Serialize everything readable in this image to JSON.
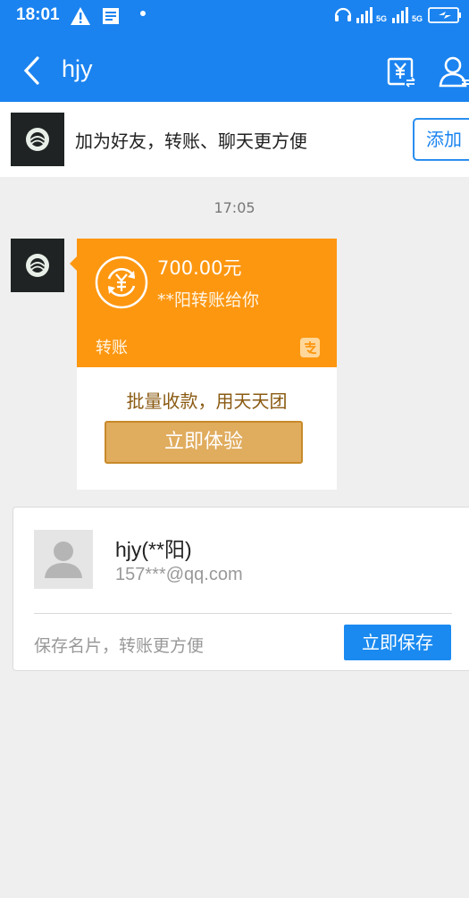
{
  "status_bar": {
    "time": "18:01",
    "network_tag_1": "5G",
    "network_tag_2": "5G"
  },
  "header": {
    "title": "hjy",
    "back_icon": "chevron-left-icon",
    "transfer_icon": "yuan-transfer-icon",
    "profile_icon": "person-icon",
    "bg_color": "#1a83f0"
  },
  "add_friend_banner": {
    "text": "加为好友，转账、聊天更方便",
    "button_label": "添加"
  },
  "conversation": {
    "timestamp": "17:05"
  },
  "transfer_card": {
    "amount": "700.00元",
    "from_text": "**阳转账给你",
    "label": "转账",
    "promo_text": "批量收款，用天天团",
    "button_label": "立即体验",
    "accent_color": "#fd9710"
  },
  "contact_card": {
    "name": "hjy(**阳)",
    "email": "157***@qq.com",
    "tip": "保存名片，转账更方便",
    "save_button": "立即保存"
  }
}
